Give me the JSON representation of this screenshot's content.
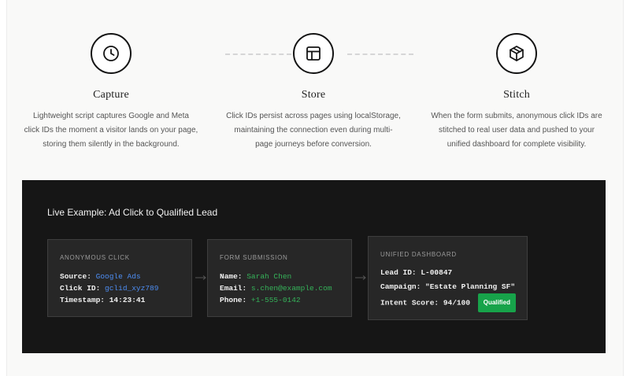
{
  "steps": [
    {
      "icon": "clock-icon",
      "title": "Capture",
      "desc_lines": [
        "Lightweight script captures Google and Meta",
        "click IDs the moment a visitor lands on your page,",
        "storing them silently in the background."
      ]
    },
    {
      "icon": "layout-grid-icon",
      "title": "Store",
      "desc_lines": [
        "Click IDs persist across pages using localStorage,",
        "maintaining the connection even during multi-",
        "page journeys before conversion."
      ]
    },
    {
      "icon": "package-cube-icon",
      "title": "Stitch",
      "desc_lines": [
        "When the form submits, anonymous click IDs are",
        "stitched to real user data and pushed to your",
        "unified dashboard for complete visibility."
      ]
    }
  ],
  "demo": {
    "title": "Live Example: Ad Click to Qualified Lead",
    "anonymous_click": {
      "heading": "ANONYMOUS CLICK",
      "source_label": "Source:",
      "source_value": "Google Ads",
      "click_id_label": "Click ID:",
      "click_id_value": "gclid_xyz789",
      "timestamp_label": "Timestamp:",
      "timestamp_value": "14:23:41"
    },
    "form_submission": {
      "heading": "FORM SUBMISSION",
      "name_label": "Name:",
      "name_value": "Sarah Chen",
      "email_label": "Email:",
      "email_value": "s.chen@example.com",
      "phone_label": "Phone:",
      "phone_value": "+1-555-0142"
    },
    "unified_dashboard": {
      "heading": "UNIFIED DASHBOARD",
      "lead_id_label": "Lead ID:",
      "lead_id_value": "L-00847",
      "campaign_label": "Campaign:",
      "campaign_value": "\"Estate Planning SF\"",
      "intent_label": "Intent Score:",
      "intent_value": "94/100",
      "badge": "Qualified"
    }
  },
  "colors": {
    "panel_bg": "#161616",
    "card_bg": "#272727",
    "blue_value": "#4d8df2",
    "green_value": "#35b259",
    "badge_green": "#17a34a"
  }
}
